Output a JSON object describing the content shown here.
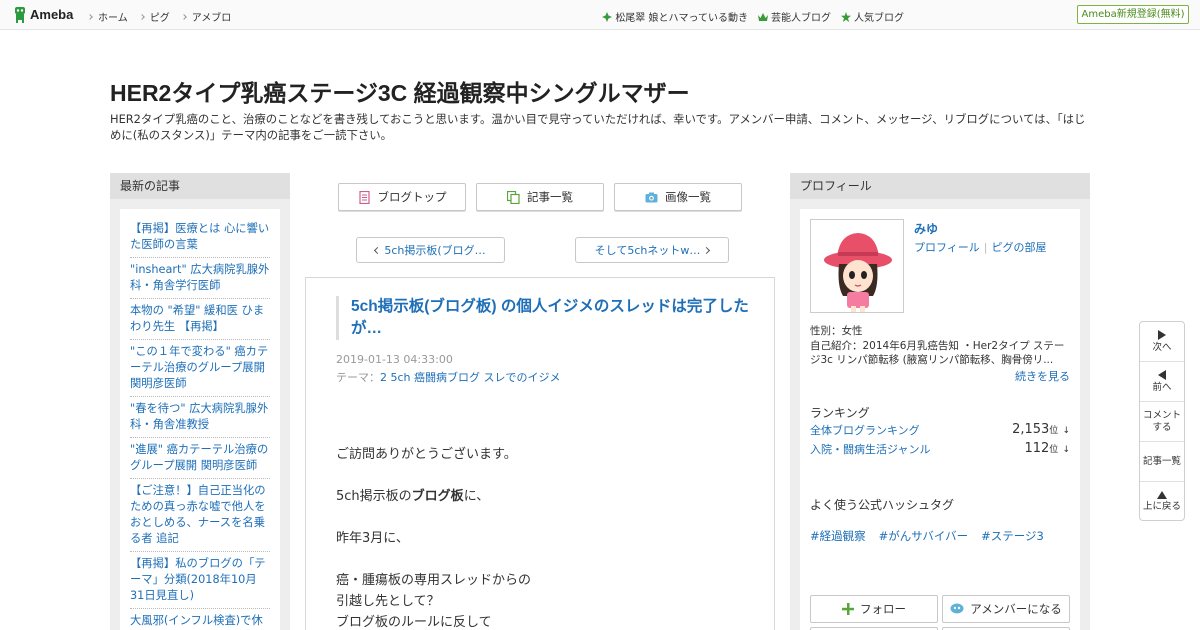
{
  "topbar": {
    "logo": "Ameba",
    "nav": [
      "ホーム",
      "ピグ",
      "アメブロ"
    ],
    "right_links": [
      "松尾翠 娘とハマっている動き",
      "芸能人ブログ",
      "人気ブログ"
    ],
    "register": "Ameba新規登録(無料)"
  },
  "blog": {
    "title": "HER2タイプ乳癌ステージ3C 経過観察中シングルマザー",
    "description": "HER2タイプ乳癌のこと、治療のことなどを書き残しておこうと思います。温かい目で見守っていただければ、幸いです。アメンバー申請、コメント、メッセージ、リブログについては、「はじめに(私のスタンス)」テーマ内の記事をご一読下さい。"
  },
  "left": {
    "heading": "最新の記事",
    "items": [
      "【再掲】医療とは 心に響いた医師の言葉",
      "\"insheart\" 広大病院乳腺外科・角舎学行医師",
      "本物の \"希望\" 緩和医 ひまわり先生 【再掲】",
      "\"この１年で変わる\" 癌カテーテル治療のグループ展開 関明彦医師",
      "\"春を待つ\" 広大病院乳腺外科・角舎准教授",
      "\"進展\" 癌カテーテル治療のグループ展開 関明彦医師",
      "【ご注意！】自己正当化のための真っ赤な嘘で他人をおとしめる、ナースを名乗る者 追記",
      "【再掲】私のブログの「テーマ」分類(2018年10月31日見直し)",
      "大風邪(インフル検査)で休"
    ]
  },
  "center": {
    "buttons": [
      "ブログトップ",
      "記事一覧",
      "画像一覧"
    ],
    "prev": "5ch掲示板(ブログ…",
    "next": "そして5chネットw…",
    "article": {
      "title": "5ch掲示板(ブログ板) の個人イジメのスレッドは完了したが…",
      "date": "2019-01-13 04:33:00",
      "theme_label": "テーマ：",
      "theme": "2 5ch 癌闘病ブログ スレでのイジメ",
      "p1": "ご訪問ありがとうございます。",
      "p2a": "5ch掲示板の",
      "p2b": "ブログ板",
      "p2c": "に、",
      "p3": "昨年3月に、",
      "p4": "癌・腫瘍板の専用スレッドからの",
      "p5": "引越し先として？",
      "p6": "ブログ板のルールに反して"
    }
  },
  "right": {
    "heading": "プロフィール",
    "name": "みゆ",
    "link_profile": "プロフィール",
    "link_pigg": "ピグの部屋",
    "gender": "性別：女性",
    "intro1": "自己紹介：2014年6月乳癌告知 ・Her2タイプ ステー",
    "intro2": "ジ3c リンパ節転移 (腋窩リンパ節転移、胸骨傍リ...",
    "more": "続きを見る",
    "ranking_heading": "ランキング",
    "rank1_label": "全体ブログランキング",
    "rank1_value": "2,153",
    "rank2_label": "入院・闘病生活ジャンル",
    "rank2_value": "112",
    "rank_unit": "位",
    "rank_arrow": "↓",
    "hashtag_heading": "よく使う公式ハッシュタグ",
    "hashtags": [
      "#経過観察",
      "#がんサバイバー",
      "#ステージ3"
    ],
    "follow": "フォロー",
    "member": "アメンバーになる"
  },
  "sidenav": {
    "next": "次へ",
    "prev": "前へ",
    "comment1": "コメント",
    "comment2": "する",
    "list": "記事一覧",
    "top": "上に戻る"
  },
  "colors": {
    "link": "#1e6fb8",
    "accent_green": "#4a8b1b",
    "panel_bg": "#eeeeee"
  }
}
